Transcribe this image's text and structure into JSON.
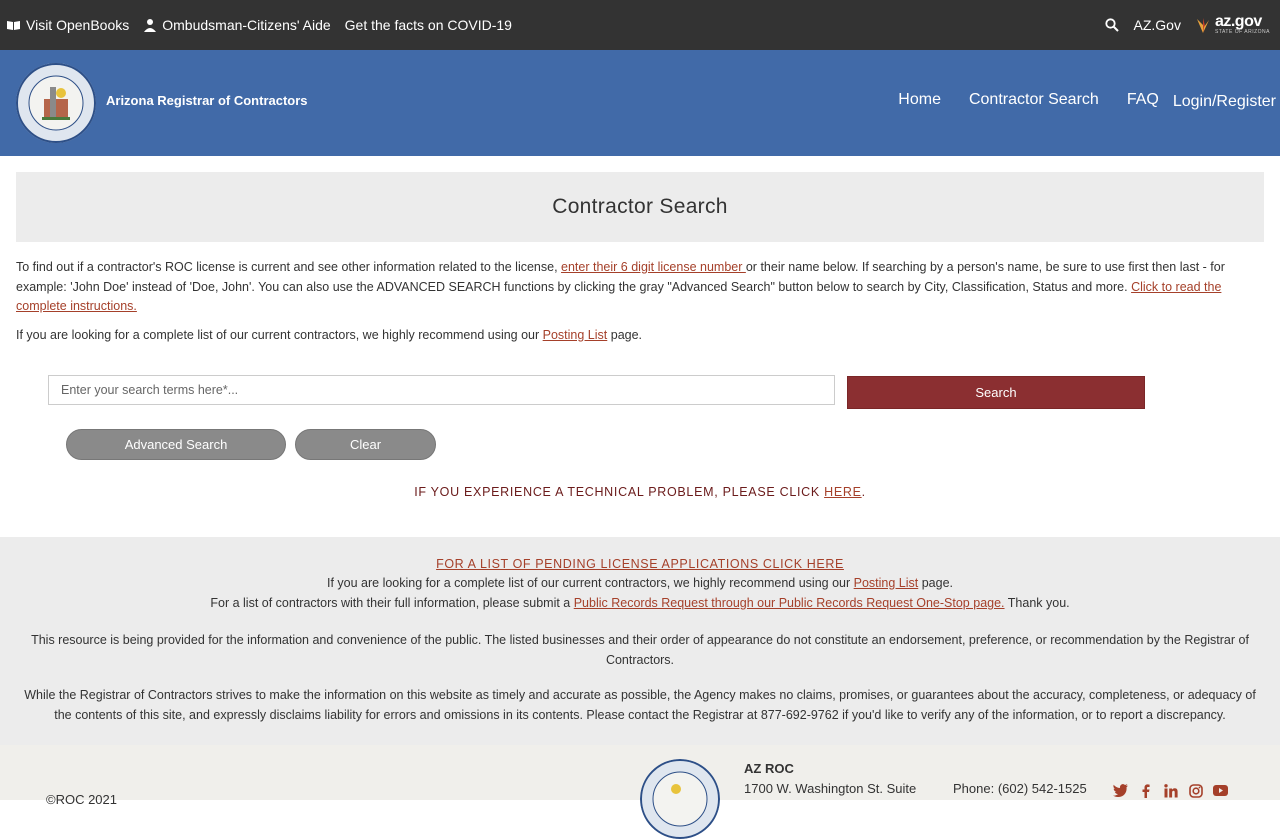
{
  "topbar": {
    "openbooks": "Visit OpenBooks",
    "ombudsman": "Ombudsman-Citizens' Aide",
    "covid": "Get the facts on COVID-19",
    "azgov_link": "AZ.Gov",
    "azgov_logo": "az.gov",
    "azgov_sub": "STATE OF ARIZONA"
  },
  "header": {
    "brand": "Arizona Registrar of Contractors",
    "nav": [
      "Home",
      "Contractor Search",
      "FAQ",
      "Login/Register"
    ]
  },
  "page": {
    "title": "Contractor Search",
    "intro_a": "To find out if a contractor's ROC license is current and see other information related to the license, ",
    "intro_link1": "enter their 6 digit license number ",
    "intro_b": "or their name below. If searching by a person's name, be sure to use first then last - for example: 'John Doe' instead of 'Doe, John'. You can also use the ADVANCED SEARCH functions by clicking the gray \"Advanced Search\" button below to search by City, Classification, Status and more. ",
    "intro_link2": "Click to read the complete instructions.",
    "posting_a": "If you are looking for a complete list of our current contractors, we highly recommend using our ",
    "posting_link": "Posting List",
    "posting_b": " page."
  },
  "search": {
    "placeholder": "Enter your search terms here*...",
    "button": "Search",
    "advanced": "Advanced Search",
    "clear": "Clear"
  },
  "tech": {
    "text": "IF YOU EXPERIENCE A TECHNICAL PROBLEM, PLEASE CLICK ",
    "link": "HERE",
    "end": "."
  },
  "info": {
    "pending_link": "FOR A LIST OF PENDING LICENSE APPLICATIONS CLICK HERE",
    "l1_a": "If you are looking for a complete list of our current contractors, we highly recommend using our ",
    "l1_link": "Posting List",
    "l1_b": " page.",
    "l2_a": "For a list of contractors with their full information, please submit a ",
    "l2_link": "Public Records Request through our Public Records Request One-Stop page.",
    "l2_b": " Thank you.",
    "p1": "This resource is being provided for the information and convenience of the public. The listed businesses and their order of appearance do not constitute an endorsement, preference, or recommendation by the Registrar of Contractors.",
    "p2": "While the Registrar of Contractors strives to make the information on this website as timely and accurate as possible, the Agency makes no claims, promises, or guarantees about the accuracy, completeness, or adequacy of the contents of this site, and expressly disclaims liability for errors and omissions in its contents. Please contact the Registrar at 877-692-9762 if you'd like to verify any of the information, or to report a discrepancy."
  },
  "footer": {
    "copyright": "©ROC 2021",
    "org": "AZ ROC",
    "address": "1700 W. Washington St. Suite",
    "phone": "Phone: (602) 542-1525",
    "social": [
      "twitter-icon",
      "facebook-icon",
      "linkedin-icon",
      "instagram-icon",
      "youtube-icon"
    ]
  },
  "colors": {
    "header": "#416aa8",
    "topbar": "#333333",
    "search_button": "#8b2f31",
    "link": "#a5402a",
    "pill": "#8a8a8a"
  }
}
